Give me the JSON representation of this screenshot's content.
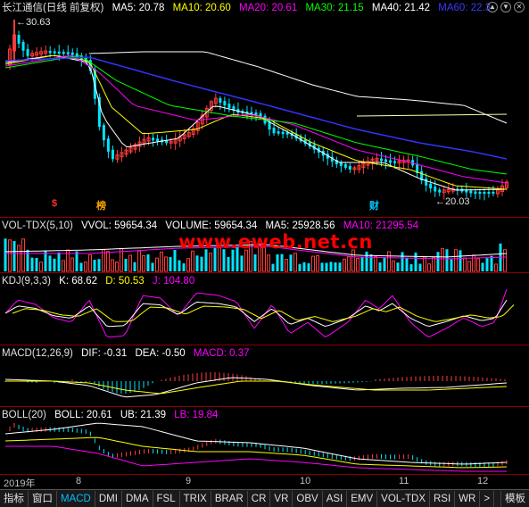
{
  "colors": {
    "up": "#ff3b3b",
    "down": "#00e5ff",
    "ma5": "#ffffff",
    "ma10": "#ffff00",
    "ma20": "#ff00ff",
    "ma30": "#00ff00",
    "ma40": "#ffffff",
    "ma60": "#0000ff",
    "separator": "#8b0000",
    "watermark": "#ff0000"
  },
  "main": {
    "title": "长江通信(日线 前复权)",
    "ma5": "MA5: 20.78",
    "ma10": "MA10: 20.60",
    "ma20": "MA20: 20.61",
    "ma30": "MA30: 21.15",
    "ma40": "MA40: 21.42",
    "ma60": "MA60: 22.3",
    "high_label": "30.63",
    "low_label": "20.03",
    "marker_dollar": "$",
    "marker_bang": "榜",
    "marker_cai": "财"
  },
  "volume": {
    "name": "VOL-TDX(5,10)",
    "vvol": "VVOL: 59654.34",
    "volume": "VOLUME: 59654.34",
    "ma5": "MA5: 25928.56",
    "ma10": "MA10: 21295.54"
  },
  "watermark": "www.eweb.net.cn",
  "kdj": {
    "name": "KDJ(9,3,3)",
    "k": "K: 68.62",
    "d": "D: 50.53",
    "j": "J: 104.80"
  },
  "macd": {
    "name": "MACD(12,26,9)",
    "dif": "DIF: -0.31",
    "dea": "DEA: -0.50",
    "macd": "MACD: 0.37"
  },
  "boll": {
    "name": "BOLL(20)",
    "boll": "BOLL: 20.61",
    "ub": "UB: 21.39",
    "lb": "LB: 19.84"
  },
  "xaxis": {
    "start": "2019年",
    "m8": "8",
    "m9": "9",
    "m10": "10",
    "m11": "11",
    "m12": "12"
  },
  "tabs": [
    "指标",
    "窗口",
    "MACD",
    "DMI",
    "DMA",
    "FSL",
    "TRIX",
    "BRAR",
    "CR",
    "VR",
    "OBV",
    "ASI",
    "EMV",
    "VOL-TDX",
    "RSI",
    "WR",
    ">"
  ],
  "tab_right": "模板",
  "controls": {
    "up": "▲",
    "down": "▼",
    "close": "✕"
  }
}
